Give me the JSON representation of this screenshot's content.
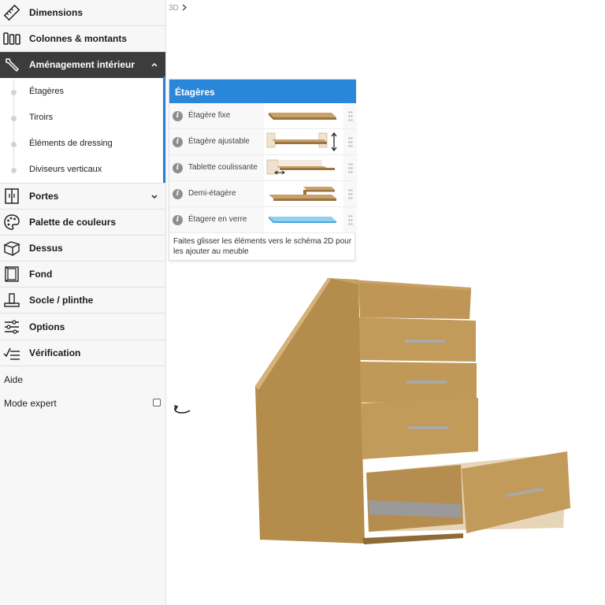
{
  "sidebar": {
    "items": [
      {
        "label": "Dimensions",
        "icon": "ruler-icon"
      },
      {
        "label": "Colonnes & montants",
        "icon": "columns-icon"
      },
      {
        "label": "Aménagement intérieur",
        "icon": "wrench-icon",
        "expanded": true
      },
      {
        "label": "Portes",
        "icon": "door-icon",
        "collapsed": true
      },
      {
        "label": "Palette de couleurs",
        "icon": "palette-icon"
      },
      {
        "label": "Dessus",
        "icon": "top-box-icon"
      },
      {
        "label": "Fond",
        "icon": "back-panel-icon"
      },
      {
        "label": "Socle / plinthe",
        "icon": "plinth-icon"
      },
      {
        "label": "Options",
        "icon": "sliders-icon"
      },
      {
        "label": "Vérification",
        "icon": "checklist-icon"
      }
    ],
    "sub_items": [
      "Étagères",
      "Tiroirs",
      "Éléments de dressing",
      "Diviseurs verticaux"
    ],
    "help": "Aide",
    "expert_mode": "Mode expert"
  },
  "view_label": "3D",
  "panel": {
    "title": "Étagères",
    "rows": [
      {
        "label": "Étagère fixe",
        "thumb": "fixed-shelf"
      },
      {
        "label": "Étagère ajustable",
        "thumb": "adjustable-shelf"
      },
      {
        "label": "Tablette coulissante",
        "thumb": "sliding-shelf"
      },
      {
        "label": "Demi-étagère",
        "thumb": "half-shelf"
      },
      {
        "label": "Étagere en verre",
        "thumb": "glass-shelf"
      }
    ],
    "footer": "Faites glisser les éléments vers le schéma 2D pour les ajouter au meuble"
  },
  "colors": {
    "accent": "#2a86d9",
    "active_nav": "#3c3c3c",
    "wood": "#b48c4c"
  }
}
